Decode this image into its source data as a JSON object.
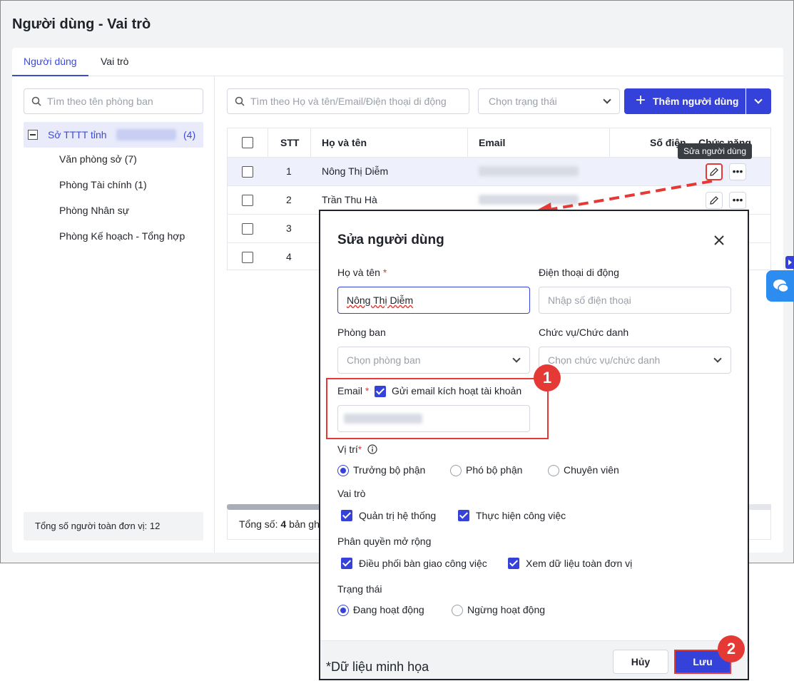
{
  "page_title": "Người dùng - Vai trò",
  "tabs": [
    {
      "label": "Người dùng",
      "active": true
    },
    {
      "label": "Vai trò",
      "active": false
    }
  ],
  "left": {
    "search_placeholder": "Tìm theo tên phòng ban",
    "root": {
      "label": "Sở TTTT tỉnh",
      "count": "(4)"
    },
    "children": [
      {
        "label": "Văn phòng sở",
        "count": "(7)"
      },
      {
        "label": "Phòng Tài chính",
        "count": "(1)"
      },
      {
        "label": "Phòng Nhân sự",
        "count": ""
      },
      {
        "label": "Phòng Kế hoạch - Tổng hợp",
        "count": ""
      }
    ],
    "footer": "Tổng số người toàn đơn vị: 12"
  },
  "toolbar": {
    "search_placeholder": "Tìm theo Họ và tên/Email/Điện thoại di động",
    "status_placeholder": "Chọn trạng thái",
    "add_button": "Thêm người dùng"
  },
  "table": {
    "headers": {
      "stt": "STT",
      "name": "Họ và tên",
      "email": "Email",
      "phone": "Số điện",
      "actions": "Chức năng"
    },
    "rows": [
      {
        "stt": "1",
        "name": "Nông Thị Diễm"
      },
      {
        "stt": "2",
        "name": "Trần Thu Hà"
      },
      {
        "stt": "3",
        "name": ""
      },
      {
        "stt": "4",
        "name": ""
      }
    ],
    "tooltip": "Sửa người dùng",
    "footer_prefix": "Tổng số:",
    "footer_count": "4",
    "footer_suffix": "bản gh"
  },
  "dialog": {
    "title": "Sửa người dùng",
    "name_label": "Họ và tên",
    "name_value": "Nông Thị Diễm",
    "phone_label": "Điện thoại di động",
    "phone_placeholder": "Nhập số điện thoại",
    "dept_label": "Phòng ban",
    "dept_placeholder": "Chọn phòng ban",
    "title_label": "Chức vụ/Chức danh",
    "title_placeholder": "Chọn chức vụ/chức danh",
    "email_label": "Email",
    "email_activation": "Gửi email kích hoạt tài khoản",
    "position_label": "Vị trí",
    "positions": [
      "Trưởng bộ phận",
      "Phó bộ phận",
      "Chuyên viên"
    ],
    "position_selected": "Trưởng bộ phận",
    "role_label": "Vai trò",
    "roles": [
      "Quản trị hệ thống",
      "Thực hiện công việc"
    ],
    "perm_label": "Phân quyền mở rộng",
    "perms": [
      "Điều phối bàn giao công việc",
      "Xem dữ liệu toàn đơn vị"
    ],
    "status_label": "Trạng thái",
    "statuses": [
      "Đang hoạt động",
      "Ngừng hoạt động"
    ],
    "status_selected": "Đang hoạt động",
    "cancel": "Hủy",
    "save": "Lưu",
    "note": "*Dữ liệu minh họa"
  },
  "steps": [
    "1",
    "2"
  ],
  "colors": {
    "accent": "#3442d9",
    "highlight": "#e53935"
  }
}
